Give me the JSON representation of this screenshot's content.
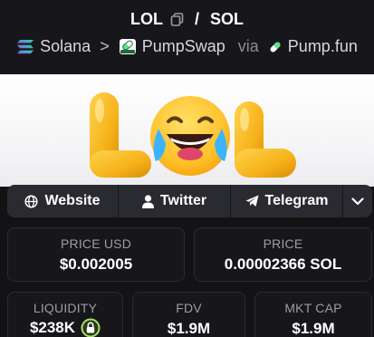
{
  "header": {
    "pair_base": "LOL",
    "pair_sep": "/",
    "pair_quote": "SOL",
    "chain": "Solana",
    "breadcrumb_sep": ">",
    "dex": "PumpSwap",
    "via": "via",
    "launchpad": "Pump.fun"
  },
  "banner": {
    "logo_text": "LOL"
  },
  "links": {
    "website": "Website",
    "twitter": "Twitter",
    "telegram": "Telegram"
  },
  "stats": {
    "price_usd_label": "PRICE USD",
    "price_usd_value": "$0.002005",
    "price_label": "PRICE",
    "price_value": "0.00002366 SOL",
    "liquidity_label": "LIQUIDITY",
    "liquidity_value": "$238K",
    "fdv_label": "FDV",
    "fdv_value": "$1.9M",
    "mktcap_label": "MKT CAP",
    "mktcap_value": "$1.9M"
  },
  "colors": {
    "background": "#131316",
    "panel": "#17171b",
    "button_bar": "#2a2a31",
    "solana_gradient": [
      "#9945ff",
      "#14f195"
    ],
    "pump_green": "#5ee28a",
    "lock_ring": "#a8e06a",
    "letter_gold": "#f6b21a",
    "emoji_yellow": "#ffcc33"
  },
  "icons": [
    "copy-icon",
    "solana-icon",
    "pumpswap-icon",
    "pumpfun-pill-icon",
    "globe-icon",
    "user-icon",
    "paper-plane-icon",
    "chevron-down-icon",
    "lock-icon"
  ]
}
